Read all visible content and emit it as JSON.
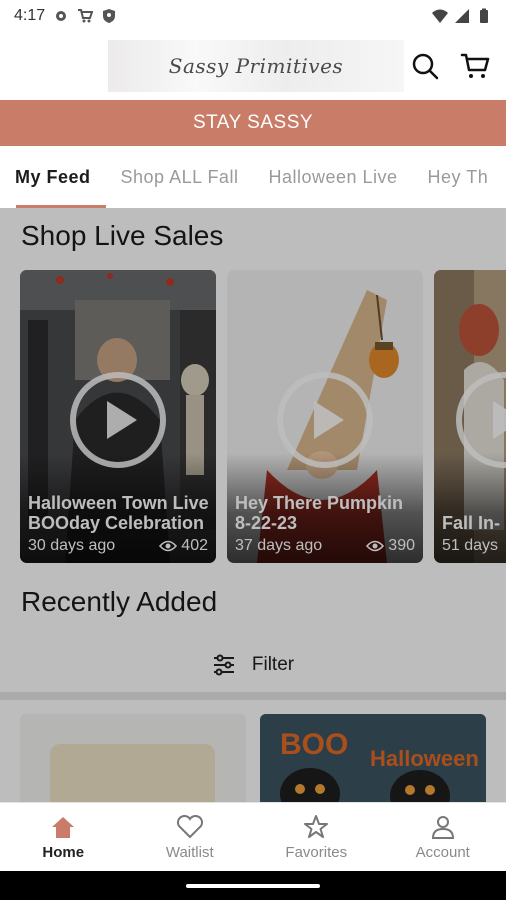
{
  "status_bar": {
    "time": "4:17",
    "icons": [
      "settings-icon",
      "cart-icon",
      "shield-icon",
      "wifi-icon",
      "signal-icon",
      "battery-icon"
    ]
  },
  "header": {
    "logo_text": "Sassy Primitives",
    "search_icon": "search-icon",
    "cart_icon": "cart-icon"
  },
  "promo": {
    "text": "STAY SASSY",
    "color": "#c97c67"
  },
  "tabs": [
    {
      "label": "My Feed",
      "active": true
    },
    {
      "label": "Shop ALL Fall",
      "active": false
    },
    {
      "label": "Halloween Live",
      "active": false
    },
    {
      "label": "Hey Th",
      "active": false
    }
  ],
  "live_sales": {
    "title": "Shop Live Sales",
    "cards": [
      {
        "title": "Halloween Town Live BOOday Celebration",
        "age": "30 days ago",
        "views": "402"
      },
      {
        "title": "Hey There Pumpkin 8-22-23",
        "age": "37 days ago",
        "views": "390"
      },
      {
        "title": "Fall In-",
        "age": "51 days",
        "views": ""
      }
    ]
  },
  "recently_added": {
    "title": "Recently Added",
    "filter_label": "Filter"
  },
  "bottom_nav": [
    {
      "label": "Home",
      "icon": "home-icon",
      "active": true
    },
    {
      "label": "Waitlist",
      "icon": "heart-icon",
      "active": false
    },
    {
      "label": "Favorites",
      "icon": "star-icon",
      "active": false
    },
    {
      "label": "Account",
      "icon": "account-icon",
      "active": false
    }
  ],
  "colors": {
    "accent": "#c97c67",
    "text": "#1c1c1c"
  }
}
